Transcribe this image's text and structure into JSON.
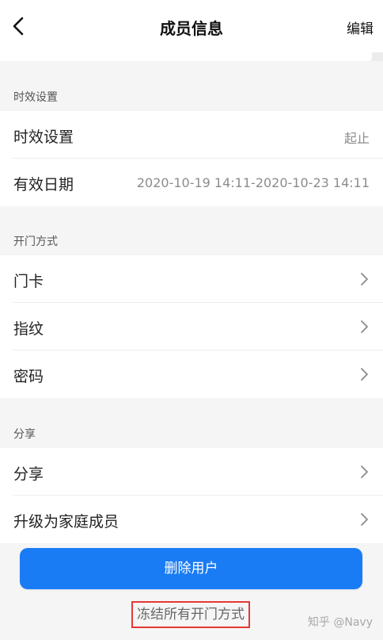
{
  "header": {
    "title": "成员信息",
    "edit_label": "编辑"
  },
  "sections": {
    "validity": {
      "header": "时效设置",
      "rows": [
        {
          "label": "时效设置",
          "value": "起止"
        },
        {
          "label": "有效日期",
          "value": "2020-10-19 14:11-2020-10-23 14:11"
        }
      ]
    },
    "unlock": {
      "header": "开门方式",
      "rows": [
        {
          "label": "门卡"
        },
        {
          "label": "指纹"
        },
        {
          "label": "密码"
        }
      ]
    },
    "share": {
      "header": "分享",
      "rows": [
        {
          "label": "分享"
        },
        {
          "label": "升级为家庭成员"
        }
      ]
    }
  },
  "actions": {
    "delete_label": "删除用户",
    "freeze_label": "冻结所有开门方式"
  },
  "watermark": "知乎 @Navy",
  "colors": {
    "primary": "#1a7cf5",
    "highlight_border": "#e53935"
  },
  "icons": {
    "back": "chevron-left-icon",
    "row_arrow": "chevron-right-icon"
  }
}
